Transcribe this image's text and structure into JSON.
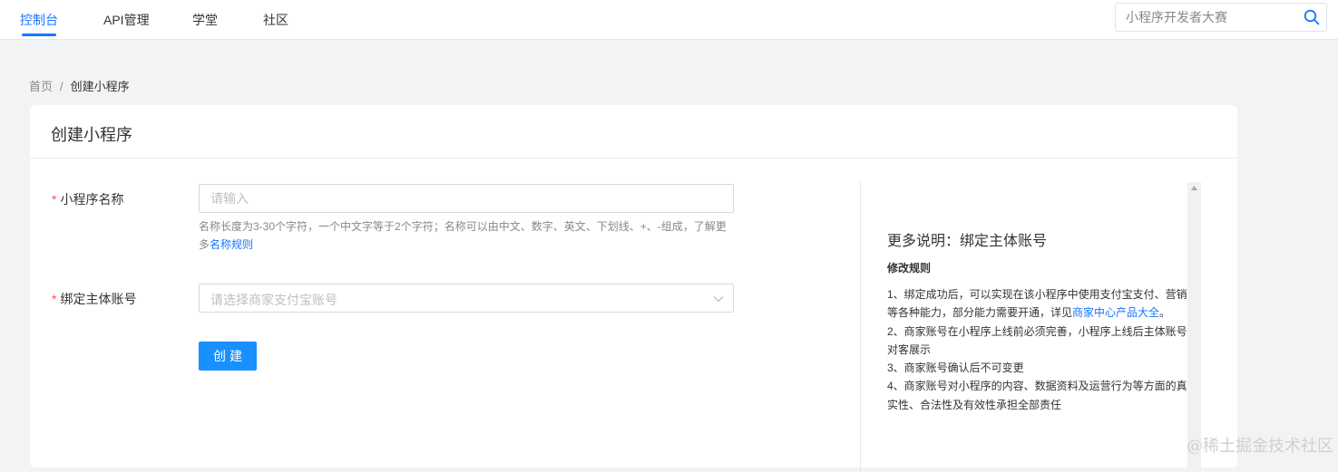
{
  "nav": {
    "tabs": [
      {
        "label": "控制台",
        "active": true
      },
      {
        "label": "API管理",
        "active": false
      },
      {
        "label": "学堂",
        "active": false
      },
      {
        "label": "社区",
        "active": false
      }
    ],
    "search_placeholder": "小程序开发者大赛",
    "accent_color": "#1677ff"
  },
  "breadcrumb": {
    "home": "首页",
    "separator": "/",
    "current": "创建小程序"
  },
  "card": {
    "title": "创建小程序"
  },
  "form": {
    "required_mark": "*",
    "name_label": "小程序名称",
    "name_placeholder": "请输入",
    "name_help_line1": "名称长度为3-30个字符，一个中文字等于2个字符；名称可以由中文、数字、英文、下划线、+、-组成，了解更",
    "name_help_line2_prefix": "多",
    "name_help_link": "名称规则",
    "account_label": "绑定主体账号",
    "account_placeholder": "请选择商家支付宝账号",
    "submit_label": "创建"
  },
  "side": {
    "title": "更多说明：绑定主体账号",
    "subtitle": "修改规则",
    "rule1_line1": "1、绑定成功后，可以实现在该小程序中使用支付宝支付、营销",
    "rule1_line2_prefix": "等各种能力，部分能力需要开通，详见",
    "rule1_link": "商家中心产品大全",
    "rule1_line2_suffix": "。",
    "rule2_line1": "2、商家账号在小程序上线前必须完善，小程序上线后主体账号",
    "rule2_line2": "对客展示",
    "rule3": "3、商家账号确认后不可变更",
    "rule4_line1": "4、商家账号对小程序的内容、数据资料及运营行为等方面的真",
    "rule4_line2": "实性、合法性及有效性承担全部责任"
  },
  "watermark": "@稀土掘金技术社区"
}
